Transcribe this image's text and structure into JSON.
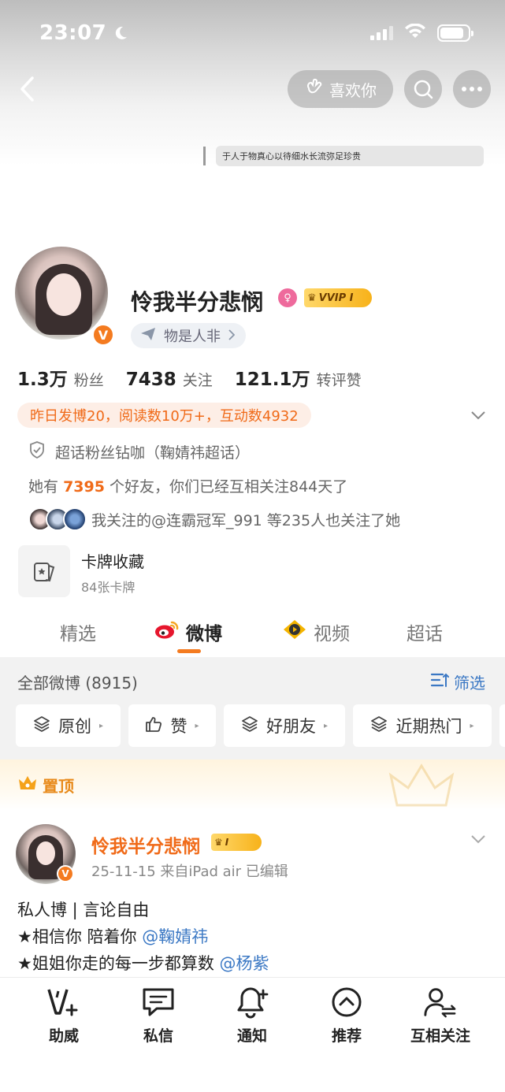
{
  "status": {
    "time": "23:07",
    "battery_level": 0.85
  },
  "header": {
    "like_label": "喜欢你"
  },
  "profile": {
    "motto": "于人于物真心以待细水长流弥足珍贵",
    "name": "怜我半分悲悯",
    "vip_label": "VVIP I",
    "location": "物是人非",
    "verified_mark": "V"
  },
  "stats": [
    {
      "value": "1.3万",
      "label": "粉丝"
    },
    {
      "value": "7438",
      "label": "关注"
    },
    {
      "value": "121.1万",
      "label": "转评赞"
    }
  ],
  "activity": "昨日发博20，阅读数10万+，互动数4932",
  "supertopic": "超话粉丝钻咖（鞠婧祎超话）",
  "friends": {
    "prefix": "她有",
    "count": "7395",
    "suffix": "个好友，你们已经互相关注844天了"
  },
  "mutual_follow": "我关注的@连霸冠军_991 等235人也关注了她",
  "card_collection": {
    "title": "卡牌收藏",
    "subtitle": "84张卡牌"
  },
  "tabs": [
    {
      "label": "精选"
    },
    {
      "label": "微博"
    },
    {
      "label": "视频"
    },
    {
      "label": "超话"
    }
  ],
  "feed": {
    "all_label": "全部微博 (8915)",
    "filter_label": "筛选",
    "chips": [
      {
        "label": "原创",
        "icon": "layers-icon"
      },
      {
        "label": "赞",
        "icon": "thumbs-up-icon"
      },
      {
        "label": "好朋友",
        "icon": "layers-icon"
      },
      {
        "label": "近期热门",
        "icon": "layers-icon"
      }
    ],
    "pinned_label": "置顶"
  },
  "post": {
    "author": "怜我半分悲悯",
    "vip_label": "I",
    "meta": "25-11-15  来自iPad air  已编辑",
    "line1": "私人博 | 言论自由",
    "line2_text": "★相信你 陪着你",
    "line2_mention": "@鞠婧祎",
    "line3_text": "★姐姐你走的每一步都算数",
    "line3_mention": "@杨紫"
  },
  "bottom_nav": [
    {
      "label": "助威",
      "icon": "cheer-icon"
    },
    {
      "label": "私信",
      "icon": "message-icon"
    },
    {
      "label": "通知",
      "icon": "bell-icon"
    },
    {
      "label": "推荐",
      "icon": "recommend-icon"
    },
    {
      "label": "互相关注",
      "icon": "mutual-follow-icon"
    }
  ],
  "colors": {
    "accent": "#f06a18",
    "link": "#3b78c4",
    "vip_gold": "#f7b21a"
  }
}
